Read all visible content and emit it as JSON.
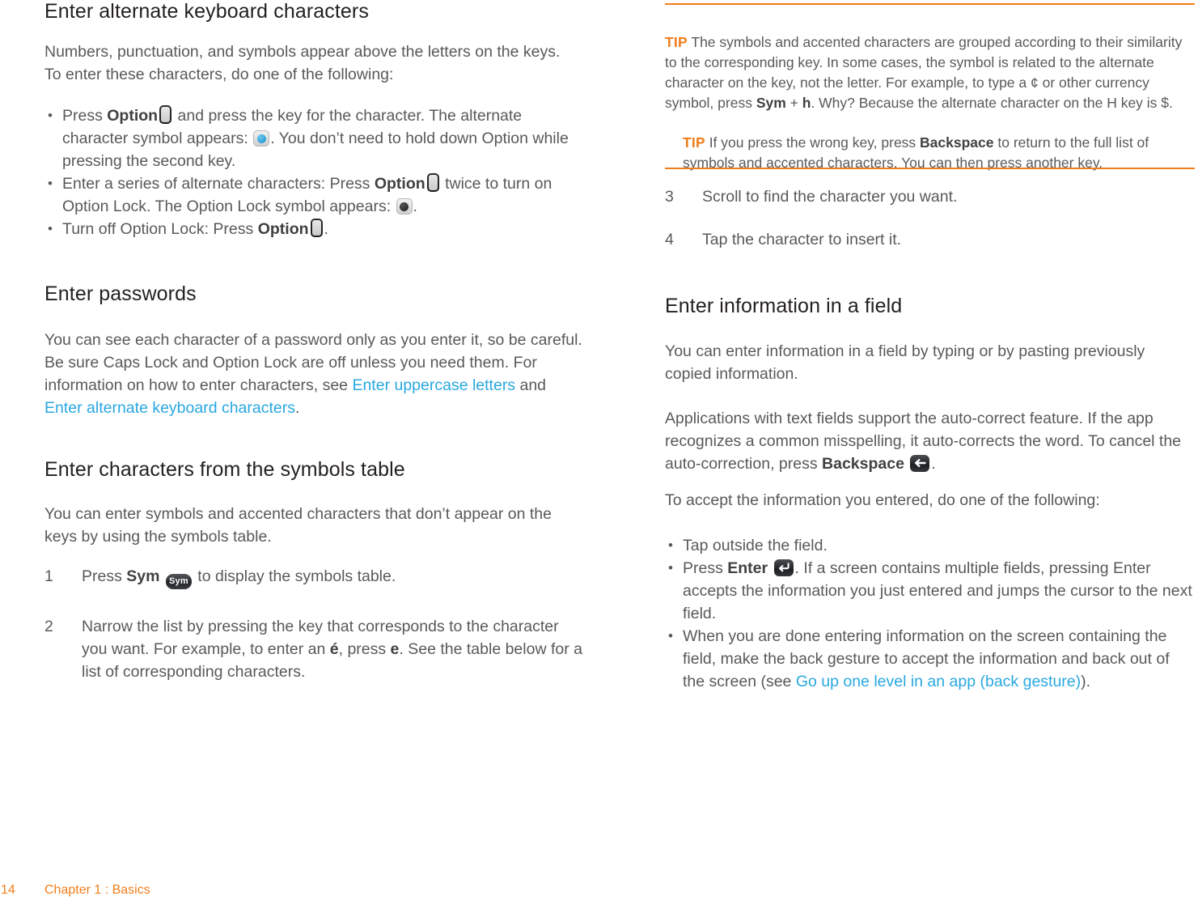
{
  "document": {
    "footer": {
      "page_number": "14",
      "chapter": "Chapter 1  :  Basics"
    },
    "colors": {
      "accent_orange": "#f07d1a",
      "link_blue": "#29a8e0",
      "heading": "#231f20",
      "body_text": "#58595b"
    }
  },
  "left_column": {
    "section1": {
      "title": "Enter alternate keyboard characters",
      "intro": "Numbers, punctuation, and symbols appear above the letters on the keys. To enter these characters, do one of the following:",
      "bullets": {
        "b1": {
          "p1": "Press ",
          "strong1": "Option",
          "p2": " and press the key for the character. The alternate character symbol appears: ",
          "p3": ". You don’t need to hold down Option while pressing the second key."
        },
        "b2": {
          "p1": "Enter a series of alternate characters: Press ",
          "strong1": "Option",
          "p2": " twice to turn on Option Lock. The Option Lock symbol appears: ",
          "p3": "."
        },
        "b3": {
          "p1": "Turn off Option Lock: Press ",
          "strong1": "Option",
          "p2": "."
        }
      }
    },
    "section2": {
      "title": "Enter passwords",
      "p1": "You can see each character of a password only as you enter it, so be careful. Be sure Caps Lock and Option Lock are off unless you need them. For information on how to enter characters, see ",
      "link1": "Enter uppercase letters",
      "p2": " and ",
      "link2": "Enter alternate keyboard characters",
      "p3": "."
    },
    "section3": {
      "title": "Enter characters from the symbols table",
      "intro": "You can enter symbols and accented characters that don’t appear on the keys by using the symbols table.",
      "steps": [
        {
          "num": "1",
          "p1": "Press ",
          "strong1": "Sym",
          "key": "Sym",
          "p2": " to display the symbols table."
        },
        {
          "num": "2",
          "p1": "Narrow the list by pressing the key that corresponds to the character you want. For example, to enter an ",
          "strong1": "é",
          "p2": ", press ",
          "strong2": "e",
          "p3": ". See the table below for a list of corresponding characters."
        }
      ]
    }
  },
  "right_column": {
    "tip1": {
      "label": "TIP",
      "p1": "  The symbols and accented characters are grouped according to their similarity to the corresponding key. In some cases, the symbol is related to the alternate character on the key, not the letter. For example, to type a ¢ or other currency symbol, press ",
      "strong1": "Sym",
      "p2": " + ",
      "strong2": "h",
      "p3": ". Why? Because the alternate character on the H key is $."
    },
    "tip2": {
      "label": "TIP",
      "p1": "  If you press the wrong key, press ",
      "strong1": "Backspace",
      "p2": " to return to the full list of symbols and accented characters. You can then press another key."
    },
    "steps": [
      {
        "num": "3",
        "text": "Scroll to find the character you want."
      },
      {
        "num": "4",
        "text": "Tap the character to insert it."
      }
    ],
    "section": {
      "title": "Enter information in a field",
      "p1": "You can enter information in a field by typing or by pasting previously copied information.",
      "p2_a": "Applications with text fields support the auto-correct feature. If the app recognizes a common misspelling, it auto-corrects the word. To cancel the auto-correction, press ",
      "p2_strong": "Backspace",
      "p2_b": ".",
      "p3": "To accept the information you entered, do one of the following:",
      "bullets": {
        "b1": {
          "p1": "Tap outside the field."
        },
        "b2": {
          "p1": "Press ",
          "strong1": "Enter",
          "p2": ". If a screen contains multiple fields, pressing Enter accepts the information you just entered and jumps the cursor to the next field."
        },
        "b3": {
          "p1": "When you are done entering information on the screen containing the field, make the back gesture to accept the information and back out of the screen (see ",
          "link1": "Go up one level in an app (back gesture)",
          "p2": ")."
        }
      }
    }
  },
  "icons": {
    "option_key": "option-key-icon",
    "alt_symbol": "alternate-character-symbol-icon",
    "option_lock_symbol": "option-lock-symbol-icon",
    "sym_key": "sym-key-icon",
    "backspace_key": "backspace-key-icon",
    "enter_key": "enter-key-icon"
  }
}
